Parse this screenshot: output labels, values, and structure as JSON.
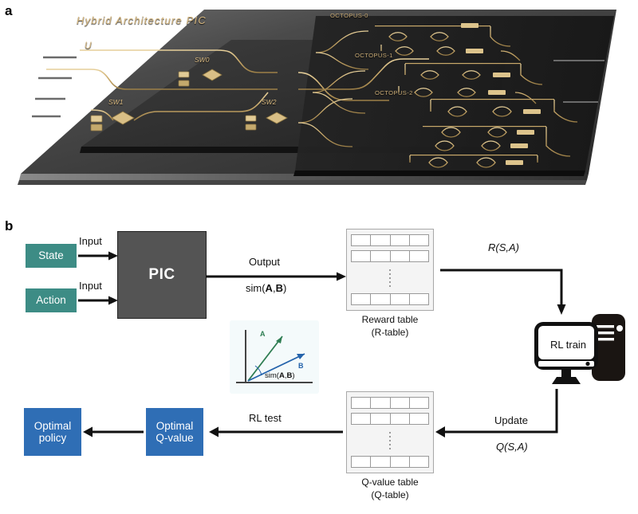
{
  "panels": {
    "a_letter": "a",
    "b_letter": "b"
  },
  "pic": {
    "title": "Hybrid  Architecture  PIC",
    "unitary_label": "U",
    "switches": [
      "SW0",
      "SW1",
      "SW2"
    ],
    "octopus_labels": [
      "OCTOPUS-0",
      "OCTOPUS-1",
      "OCTOPUS-2"
    ],
    "colors": {
      "waveguide": "#c9a96a",
      "substrate_dark": "#2b2b2b",
      "substrate_light": "#6a6a6a",
      "label_gold": "#d8b981"
    }
  },
  "flow": {
    "state_box": "State",
    "action_box": "Action",
    "pic_block": "PIC",
    "input_label_top": "Input",
    "input_label_bottom": "Input",
    "output_label": "Output",
    "output_formula_prefix": "sim(",
    "output_formula_a": "A",
    "output_formula_sep": ",",
    "output_formula_b": "B",
    "output_formula_suffix": ")",
    "reward_arrow_label": "R(S,A)",
    "update_label": "Update",
    "update_formula": "Q(S,A)",
    "rl_test_label": "RL test",
    "rl_train_label": "RL train",
    "reward_table_caption_line1": "Reward table",
    "reward_table_caption_line2": "(R-table)",
    "qvalue_table_caption_line1": "Q-value table",
    "qvalue_table_caption_line2": "(Q-table)",
    "optimal_qvalue_line1": "Optimal",
    "optimal_qvalue_line2": "Q-value",
    "optimal_policy_line1": "Optimal",
    "optimal_policy_line2": "policy",
    "colors": {
      "teal": "#3d8c85",
      "blue": "#2f6eb5",
      "pic_gray": "#545454",
      "arrow": "#111111",
      "table_fill": "#f4f4f4"
    }
  },
  "vector_inset": {
    "label_a": "A",
    "label_b": "B",
    "sim_prefix": "sim(",
    "sim_a": "A",
    "sim_sep": ",",
    "sim_b": "B",
    "sim_suffix": ")",
    "color_a": "#2e7d52",
    "color_b": "#2463ab"
  },
  "tables": {
    "rows": 3,
    "cols": 4,
    "ellipsis_dots": 5
  }
}
